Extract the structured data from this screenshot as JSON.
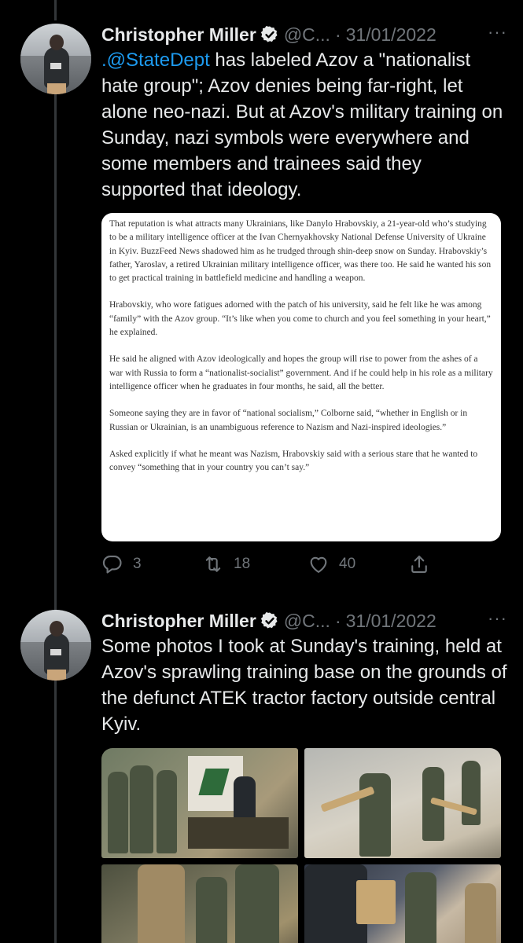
{
  "colors": {
    "background": "#000000",
    "text": "#e7e9ea",
    "muted": "#71767b",
    "link": "#1d9bf0",
    "verified": "#e7e9ea",
    "thread_line": "#333639"
  },
  "tweets": [
    {
      "author": {
        "name": "Christopher Miller",
        "handle": "@C...",
        "date": "31/01/2022",
        "avatar_icon": "avatar-photo"
      },
      "mention": ".@StateDept",
      "text_rest": " has labeled Azov a \"nationalist hate group\"; Azov denies being far-right, let alone neo-nazi. But at Azov's military training on Sunday, nazi symbols were everywhere and some members and trainees said they supported that ideology.",
      "article_paragraphs": [
        "That reputation is what attracts many Ukrainians, like Danylo Hrabovskiy, a 21-year-old who’s studying to be a military intelligence officer at the Ivan Chernyakhovsky National Defense University of Ukraine in Kyiv. BuzzFeed News shadowed him as he trudged through shin-deep snow on Sunday. Hrabovskiy’s father, Yaroslav, a retired Ukrainian military intelligence officer, was there too. He said he wanted his son to get practical training in battlefield medicine and handling a weapon.",
        "Hrabovskiy, who wore fatigues adorned with the patch of his university, said he felt like he was among “family” with the Azov group. “It’s like when you come to church and you feel something in your heart,” he explained.",
        "He said he aligned with Azov ideologically and hopes the group will rise to power from the ashes of a war with Russia to form a “nationalist-socialist” government. And if he could help in his role as a military intelligence officer when he graduates in four months, he said, all the better.",
        "Someone saying they are in favor of “national socialism,” Colborne said, “whether in English or in Russian or Ukrainian, is an unambiguous reference to Nazism and Nazi-inspired ideologies.”",
        "Asked explicitly if what he meant was Nazism, Hrabovskiy said with a serious stare that he wanted to convey “something that in your country you can’t say.”"
      ],
      "actions": {
        "reply": {
          "icon": "reply-icon",
          "count": "3"
        },
        "retweet": {
          "icon": "retweet-icon",
          "count": "18"
        },
        "like": {
          "icon": "heart-icon",
          "count": "40"
        },
        "share": {
          "icon": "share-icon"
        }
      }
    },
    {
      "author": {
        "name": "Christopher Miller",
        "handle": "@C...",
        "date": "31/01/2022",
        "avatar_icon": "avatar-photo"
      },
      "text": "Some photos I took at Sunday's training, held at Azov's sprawling training base on the grounds of the defunct ATEK tractor factory outside central Kyiv.",
      "photos": 4
    }
  ],
  "ui": {
    "more_icon": "more-icon",
    "more_glyph": "···",
    "dot": "·"
  }
}
